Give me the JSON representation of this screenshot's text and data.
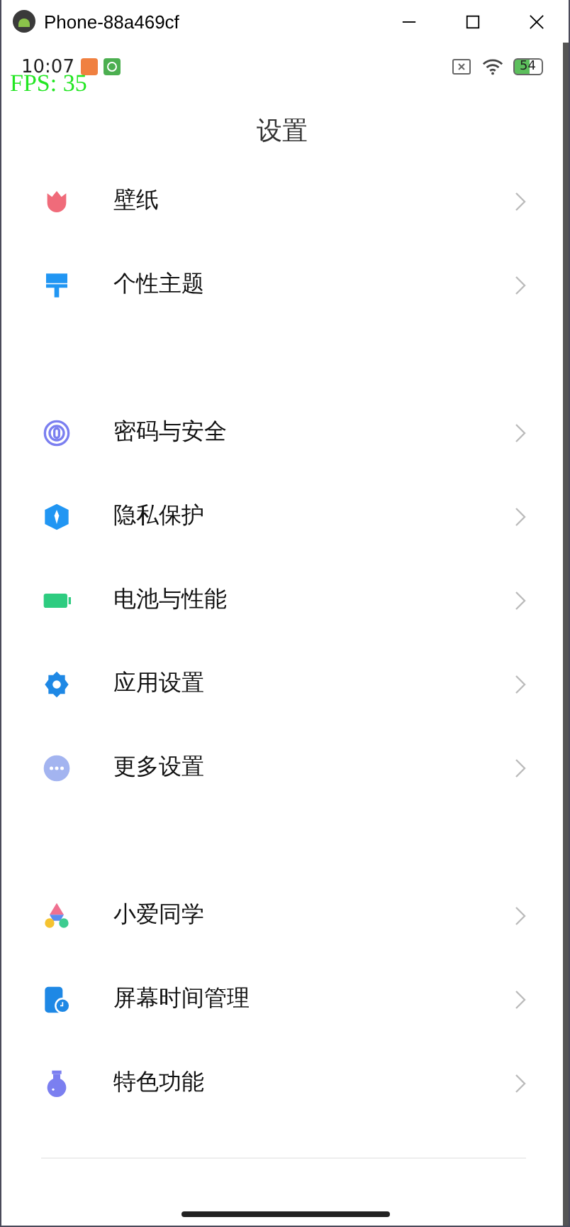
{
  "window": {
    "title": "Phone-88a469cf"
  },
  "status_bar": {
    "time": "10:07",
    "battery": "54"
  },
  "fps": "FPS: 35",
  "page_title": "设置",
  "groups": [
    {
      "items": [
        {
          "kind": "tulip",
          "label": "壁纸"
        },
        {
          "kind": "brush",
          "label": "个性主题"
        }
      ]
    },
    {
      "items": [
        {
          "kind": "fingerprint",
          "label": "密码与安全"
        },
        {
          "kind": "shield",
          "label": "隐私保护"
        },
        {
          "kind": "battery",
          "label": "电池与性能"
        },
        {
          "kind": "gear",
          "label": "应用设置"
        },
        {
          "kind": "dots",
          "label": "更多设置"
        }
      ]
    },
    {
      "items": [
        {
          "kind": "assistant",
          "label": "小爱同学"
        },
        {
          "kind": "screentime",
          "label": "屏幕时间管理"
        },
        {
          "kind": "flask",
          "label": "特色功能"
        }
      ]
    }
  ]
}
